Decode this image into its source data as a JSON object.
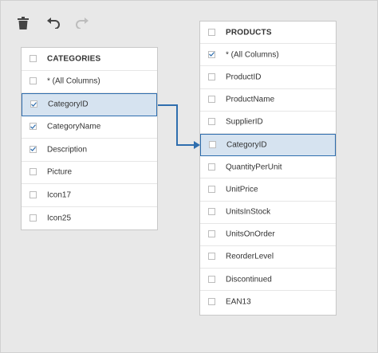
{
  "toolbar": {
    "delete_icon": "trash-icon",
    "undo_icon": "undo-icon",
    "redo_icon": "redo-icon"
  },
  "categories": {
    "title": "CATEGORIES",
    "rows": [
      {
        "label": "* (All Columns)",
        "checked": false,
        "selected": false
      },
      {
        "label": "CategoryID",
        "checked": true,
        "selected": true
      },
      {
        "label": "CategoryName",
        "checked": true,
        "selected": false
      },
      {
        "label": "Description",
        "checked": true,
        "selected": false
      },
      {
        "label": "Picture",
        "checked": false,
        "selected": false
      },
      {
        "label": "Icon17",
        "checked": false,
        "selected": false
      },
      {
        "label": "Icon25",
        "checked": false,
        "selected": false
      }
    ]
  },
  "products": {
    "title": "PRODUCTS",
    "rows": [
      {
        "label": "* (All Columns)",
        "checked": true,
        "selected": false
      },
      {
        "label": "ProductID",
        "checked": false,
        "selected": false
      },
      {
        "label": "ProductName",
        "checked": false,
        "selected": false
      },
      {
        "label": "SupplierID",
        "checked": false,
        "selected": false
      },
      {
        "label": "CategoryID",
        "checked": false,
        "selected": true
      },
      {
        "label": "QuantityPerUnit",
        "checked": false,
        "selected": false
      },
      {
        "label": "UnitPrice",
        "checked": false,
        "selected": false
      },
      {
        "label": "UnitsInStock",
        "checked": false,
        "selected": false
      },
      {
        "label": "UnitsOnOrder",
        "checked": false,
        "selected": false
      },
      {
        "label": "ReorderLevel",
        "checked": false,
        "selected": false
      },
      {
        "label": "Discontinued",
        "checked": false,
        "selected": false
      },
      {
        "label": "EAN13",
        "checked": false,
        "selected": false
      }
    ]
  },
  "colors": {
    "accent": "#2f6eae",
    "selected_bg": "#d6e3f0",
    "canvas_bg": "#e8e8e8"
  }
}
